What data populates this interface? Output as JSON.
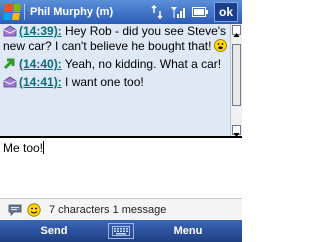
{
  "titlebar": {
    "title": "Phil Murphy (m)",
    "ok_label": "ok"
  },
  "conversation": [
    {
      "time": "(14:39):",
      "text": " Hey Rob - did you see Steve's new car? I can't believe he bought that!",
      "icon": "incoming-message-icon",
      "has_smiley": true
    },
    {
      "time": "(14:40):",
      "text": " Yeah, no kidding. What a car!",
      "icon": "outgoing-message-icon",
      "has_smiley": false
    },
    {
      "time": "(14:41):",
      "text": " I want one too!",
      "icon": "incoming-message-icon",
      "has_smiley": false
    }
  ],
  "input": {
    "value": "Me too!"
  },
  "status": {
    "count_text": "7 characters 1 message"
  },
  "softkeys": {
    "left": "Send",
    "right": "Menu"
  },
  "colors": {
    "timestamp": "#0a6c7a",
    "conversation_bg": "#dfe8f5",
    "titlebar": "#2b5cb8"
  }
}
